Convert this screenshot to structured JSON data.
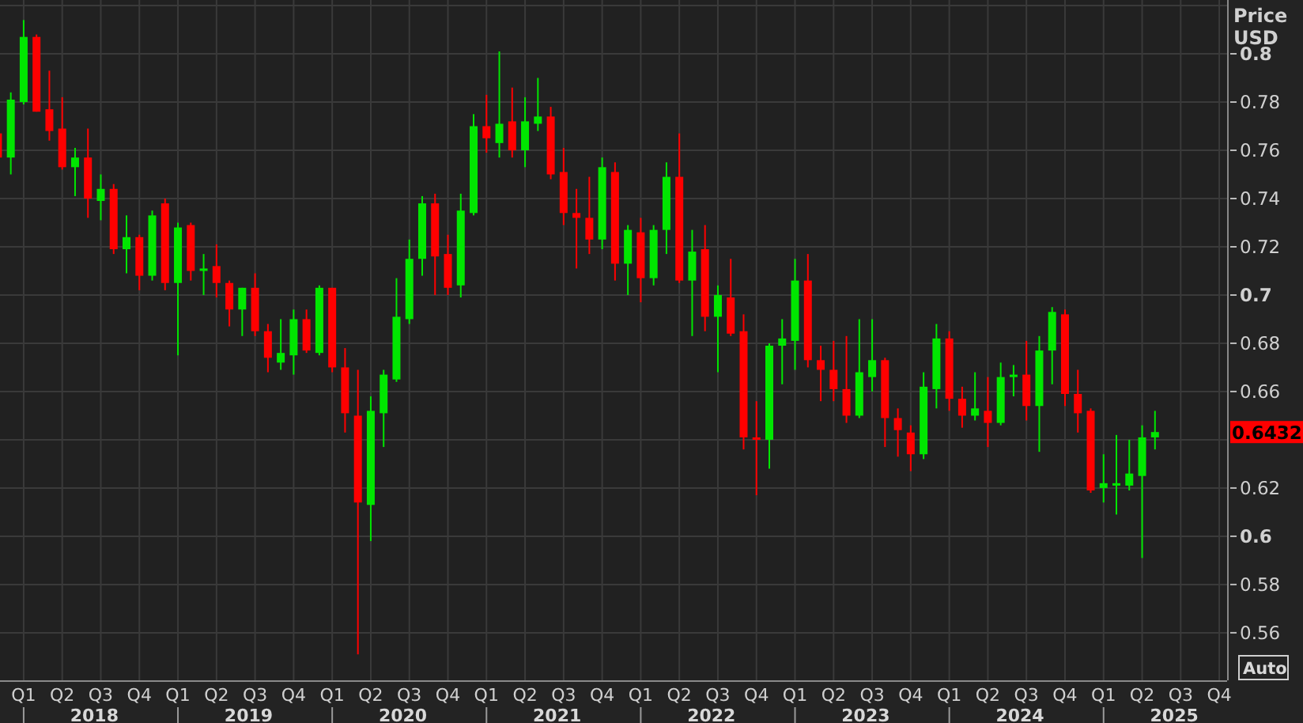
{
  "chart": {
    "axis_title": "Price",
    "axis_unit": "USD",
    "auto_button": "Auto",
    "years": [
      "2018",
      "2019",
      "2020",
      "2021",
      "2022",
      "2023",
      "2024",
      "2025"
    ],
    "chart_data": {
      "type": "candlestick",
      "grid": true,
      "ylim": [
        0.5403,
        0.8223
      ],
      "yticks": [
        0.8,
        0.78,
        0.76,
        0.74,
        0.72,
        0.7,
        0.68,
        0.66,
        0.62,
        0.6,
        0.58,
        0.56
      ],
      "categories": [
        null,
        null,
        "Q1",
        null,
        null,
        "Q2",
        null,
        null,
        "Q3",
        null,
        null,
        "Q4",
        null,
        null,
        "Q1",
        null,
        null,
        "Q2",
        null,
        null,
        "Q3",
        null,
        null,
        "Q4",
        null,
        null,
        "Q1",
        null,
        null,
        "Q2",
        null,
        null,
        "Q3",
        null,
        null,
        "Q4",
        null,
        null,
        "Q1",
        null,
        null,
        "Q2",
        null,
        null,
        "Q3",
        null,
        null,
        "Q4",
        null,
        null,
        "Q1",
        null,
        null,
        "Q2",
        null,
        null,
        "Q3",
        null,
        null,
        "Q4",
        null,
        null,
        "Q1",
        null,
        null,
        "Q2",
        null,
        null,
        "Q3",
        null,
        null,
        "Q4",
        null,
        null,
        "Q1",
        null,
        null,
        "Q2",
        null,
        null,
        "Q3",
        null,
        null,
        "Q4",
        null,
        null,
        "Q1",
        null,
        null,
        "Q2",
        null,
        null,
        "Q3",
        null,
        null,
        "Q4"
      ],
      "ohlc": [
        [
          0.767,
          0.768,
          0.755,
          0.757
        ],
        [
          0.757,
          0.784,
          0.75,
          0.781
        ],
        [
          0.78,
          0.814,
          0.779,
          0.807
        ],
        [
          0.807,
          0.808,
          0.776,
          0.776
        ],
        [
          0.777,
          0.793,
          0.764,
          0.768
        ],
        [
          0.769,
          0.782,
          0.752,
          0.753
        ],
        [
          0.753,
          0.761,
          0.741,
          0.757
        ],
        [
          0.757,
          0.769,
          0.732,
          0.74
        ],
        [
          0.739,
          0.75,
          0.731,
          0.744
        ],
        [
          0.744,
          0.746,
          0.717,
          0.719
        ],
        [
          0.719,
          0.733,
          0.709,
          0.724
        ],
        [
          0.724,
          0.725,
          0.702,
          0.708
        ],
        [
          0.708,
          0.735,
          0.706,
          0.733
        ],
        [
          0.738,
          0.74,
          0.702,
          0.705
        ],
        [
          0.705,
          0.73,
          0.675,
          0.728
        ],
        [
          0.729,
          0.73,
          0.706,
          0.71
        ],
        [
          0.71,
          0.717,
          0.7,
          0.711
        ],
        [
          0.712,
          0.721,
          0.699,
          0.705
        ],
        [
          0.705,
          0.706,
          0.687,
          0.694
        ],
        [
          0.694,
          0.703,
          0.683,
          0.703
        ],
        [
          0.703,
          0.709,
          0.683,
          0.685
        ],
        [
          0.685,
          0.688,
          0.668,
          0.674
        ],
        [
          0.672,
          0.69,
          0.669,
          0.676
        ],
        [
          0.675,
          0.694,
          0.667,
          0.69
        ],
        [
          0.69,
          0.694,
          0.676,
          0.677
        ],
        [
          0.676,
          0.704,
          0.675,
          0.703
        ],
        [
          0.703,
          0.703,
          0.668,
          0.67
        ],
        [
          0.67,
          0.678,
          0.643,
          0.651
        ],
        [
          0.65,
          0.669,
          0.551,
          0.614
        ],
        [
          0.613,
          0.658,
          0.598,
          0.652
        ],
        [
          0.651,
          0.669,
          0.637,
          0.667
        ],
        [
          0.665,
          0.707,
          0.664,
          0.691
        ],
        [
          0.69,
          0.723,
          0.688,
          0.715
        ],
        [
          0.715,
          0.741,
          0.708,
          0.738
        ],
        [
          0.738,
          0.742,
          0.7,
          0.716
        ],
        [
          0.717,
          0.725,
          0.7,
          0.703
        ],
        [
          0.704,
          0.742,
          0.699,
          0.735
        ],
        [
          0.734,
          0.775,
          0.733,
          0.77
        ],
        [
          0.77,
          0.783,
          0.759,
          0.765
        ],
        [
          0.763,
          0.801,
          0.757,
          0.771
        ],
        [
          0.772,
          0.786,
          0.757,
          0.76
        ],
        [
          0.76,
          0.782,
          0.753,
          0.772
        ],
        [
          0.771,
          0.79,
          0.768,
          0.774
        ],
        [
          0.774,
          0.778,
          0.748,
          0.75
        ],
        [
          0.751,
          0.761,
          0.729,
          0.734
        ],
        [
          0.734,
          0.744,
          0.711,
          0.732
        ],
        [
          0.732,
          0.749,
          0.717,
          0.723
        ],
        [
          0.723,
          0.757,
          0.719,
          0.753
        ],
        [
          0.751,
          0.755,
          0.706,
          0.713
        ],
        [
          0.713,
          0.729,
          0.7,
          0.727
        ],
        [
          0.726,
          0.732,
          0.697,
          0.707
        ],
        [
          0.707,
          0.729,
          0.704,
          0.727
        ],
        [
          0.727,
          0.755,
          0.717,
          0.749
        ],
        [
          0.749,
          0.767,
          0.705,
          0.706
        ],
        [
          0.706,
          0.727,
          0.683,
          0.718
        ],
        [
          0.719,
          0.729,
          0.685,
          0.691
        ],
        [
          0.691,
          0.704,
          0.668,
          0.7
        ],
        [
          0.699,
          0.715,
          0.683,
          0.684
        ],
        [
          0.685,
          0.692,
          0.636,
          0.641
        ],
        [
          0.641,
          0.656,
          0.617,
          0.64
        ],
        [
          0.64,
          0.68,
          0.628,
          0.679
        ],
        [
          0.679,
          0.69,
          0.663,
          0.682
        ],
        [
          0.681,
          0.715,
          0.669,
          0.706
        ],
        [
          0.706,
          0.717,
          0.67,
          0.673
        ],
        [
          0.673,
          0.679,
          0.656,
          0.669
        ],
        [
          0.669,
          0.681,
          0.656,
          0.661
        ],
        [
          0.661,
          0.683,
          0.647,
          0.65
        ],
        [
          0.65,
          0.69,
          0.649,
          0.668
        ],
        [
          0.666,
          0.69,
          0.66,
          0.673
        ],
        [
          0.673,
          0.674,
          0.637,
          0.649
        ],
        [
          0.649,
          0.653,
          0.633,
          0.644
        ],
        [
          0.643,
          0.646,
          0.627,
          0.634
        ],
        [
          0.634,
          0.668,
          0.632,
          0.662
        ],
        [
          0.661,
          0.688,
          0.653,
          0.682
        ],
        [
          0.682,
          0.685,
          0.652,
          0.657
        ],
        [
          0.657,
          0.662,
          0.645,
          0.65
        ],
        [
          0.65,
          0.668,
          0.648,
          0.653
        ],
        [
          0.652,
          0.666,
          0.637,
          0.647
        ],
        [
          0.647,
          0.672,
          0.646,
          0.666
        ],
        [
          0.666,
          0.671,
          0.658,
          0.667
        ],
        [
          0.667,
          0.681,
          0.648,
          0.654
        ],
        [
          0.654,
          0.683,
          0.635,
          0.677
        ],
        [
          0.677,
          0.695,
          0.663,
          0.693
        ],
        [
          0.692,
          0.694,
          0.654,
          0.659
        ],
        [
          0.659,
          0.669,
          0.643,
          0.651
        ],
        [
          0.652,
          0.653,
          0.618,
          0.619
        ],
        [
          0.62,
          0.634,
          0.614,
          0.622
        ],
        [
          0.621,
          0.642,
          0.609,
          0.622
        ],
        [
          0.621,
          0.64,
          0.619,
          0.626
        ],
        [
          0.625,
          0.646,
          0.591,
          0.641
        ],
        [
          0.641,
          0.652,
          0.636,
          0.6432
        ],
        null,
        null,
        null,
        null,
        null
      ],
      "annotations": [
        "0.6432"
      ]
    }
  }
}
